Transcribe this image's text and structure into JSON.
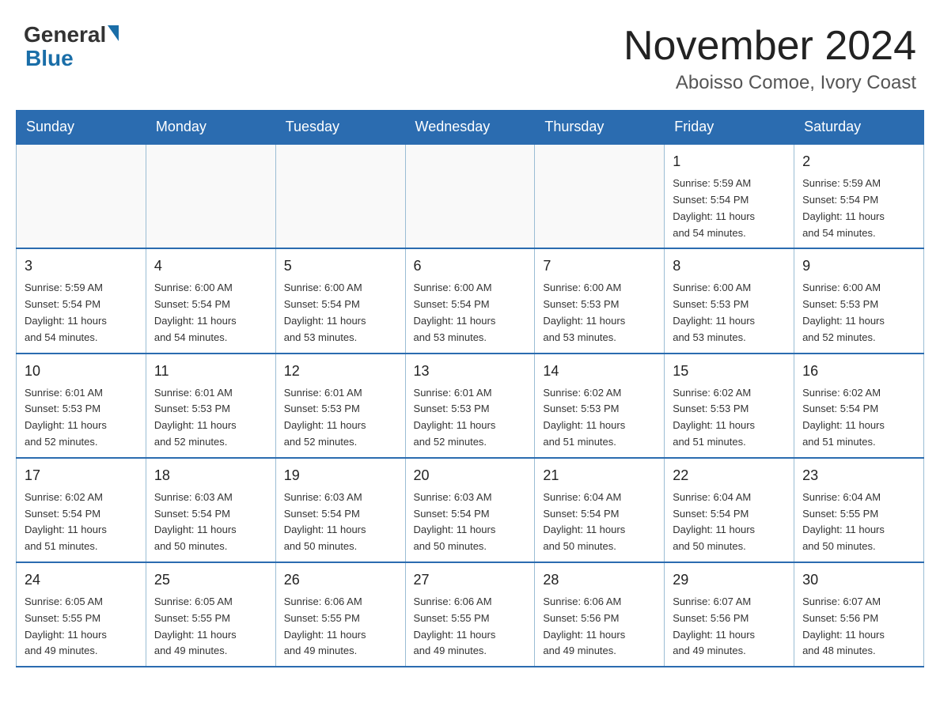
{
  "header": {
    "logo_line1": "General",
    "logo_line2": "Blue",
    "month_title": "November 2024",
    "location": "Aboisso Comoe, Ivory Coast"
  },
  "days_of_week": [
    "Sunday",
    "Monday",
    "Tuesday",
    "Wednesday",
    "Thursday",
    "Friday",
    "Saturday"
  ],
  "weeks": [
    [
      {
        "day": "",
        "info": ""
      },
      {
        "day": "",
        "info": ""
      },
      {
        "day": "",
        "info": ""
      },
      {
        "day": "",
        "info": ""
      },
      {
        "day": "",
        "info": ""
      },
      {
        "day": "1",
        "info": "Sunrise: 5:59 AM\nSunset: 5:54 PM\nDaylight: 11 hours\nand 54 minutes."
      },
      {
        "day": "2",
        "info": "Sunrise: 5:59 AM\nSunset: 5:54 PM\nDaylight: 11 hours\nand 54 minutes."
      }
    ],
    [
      {
        "day": "3",
        "info": "Sunrise: 5:59 AM\nSunset: 5:54 PM\nDaylight: 11 hours\nand 54 minutes."
      },
      {
        "day": "4",
        "info": "Sunrise: 6:00 AM\nSunset: 5:54 PM\nDaylight: 11 hours\nand 54 minutes."
      },
      {
        "day": "5",
        "info": "Sunrise: 6:00 AM\nSunset: 5:54 PM\nDaylight: 11 hours\nand 53 minutes."
      },
      {
        "day": "6",
        "info": "Sunrise: 6:00 AM\nSunset: 5:54 PM\nDaylight: 11 hours\nand 53 minutes."
      },
      {
        "day": "7",
        "info": "Sunrise: 6:00 AM\nSunset: 5:53 PM\nDaylight: 11 hours\nand 53 minutes."
      },
      {
        "day": "8",
        "info": "Sunrise: 6:00 AM\nSunset: 5:53 PM\nDaylight: 11 hours\nand 53 minutes."
      },
      {
        "day": "9",
        "info": "Sunrise: 6:00 AM\nSunset: 5:53 PM\nDaylight: 11 hours\nand 52 minutes."
      }
    ],
    [
      {
        "day": "10",
        "info": "Sunrise: 6:01 AM\nSunset: 5:53 PM\nDaylight: 11 hours\nand 52 minutes."
      },
      {
        "day": "11",
        "info": "Sunrise: 6:01 AM\nSunset: 5:53 PM\nDaylight: 11 hours\nand 52 minutes."
      },
      {
        "day": "12",
        "info": "Sunrise: 6:01 AM\nSunset: 5:53 PM\nDaylight: 11 hours\nand 52 minutes."
      },
      {
        "day": "13",
        "info": "Sunrise: 6:01 AM\nSunset: 5:53 PM\nDaylight: 11 hours\nand 52 minutes."
      },
      {
        "day": "14",
        "info": "Sunrise: 6:02 AM\nSunset: 5:53 PM\nDaylight: 11 hours\nand 51 minutes."
      },
      {
        "day": "15",
        "info": "Sunrise: 6:02 AM\nSunset: 5:53 PM\nDaylight: 11 hours\nand 51 minutes."
      },
      {
        "day": "16",
        "info": "Sunrise: 6:02 AM\nSunset: 5:54 PM\nDaylight: 11 hours\nand 51 minutes."
      }
    ],
    [
      {
        "day": "17",
        "info": "Sunrise: 6:02 AM\nSunset: 5:54 PM\nDaylight: 11 hours\nand 51 minutes."
      },
      {
        "day": "18",
        "info": "Sunrise: 6:03 AM\nSunset: 5:54 PM\nDaylight: 11 hours\nand 50 minutes."
      },
      {
        "day": "19",
        "info": "Sunrise: 6:03 AM\nSunset: 5:54 PM\nDaylight: 11 hours\nand 50 minutes."
      },
      {
        "day": "20",
        "info": "Sunrise: 6:03 AM\nSunset: 5:54 PM\nDaylight: 11 hours\nand 50 minutes."
      },
      {
        "day": "21",
        "info": "Sunrise: 6:04 AM\nSunset: 5:54 PM\nDaylight: 11 hours\nand 50 minutes."
      },
      {
        "day": "22",
        "info": "Sunrise: 6:04 AM\nSunset: 5:54 PM\nDaylight: 11 hours\nand 50 minutes."
      },
      {
        "day": "23",
        "info": "Sunrise: 6:04 AM\nSunset: 5:55 PM\nDaylight: 11 hours\nand 50 minutes."
      }
    ],
    [
      {
        "day": "24",
        "info": "Sunrise: 6:05 AM\nSunset: 5:55 PM\nDaylight: 11 hours\nand 49 minutes."
      },
      {
        "day": "25",
        "info": "Sunrise: 6:05 AM\nSunset: 5:55 PM\nDaylight: 11 hours\nand 49 minutes."
      },
      {
        "day": "26",
        "info": "Sunrise: 6:06 AM\nSunset: 5:55 PM\nDaylight: 11 hours\nand 49 minutes."
      },
      {
        "day": "27",
        "info": "Sunrise: 6:06 AM\nSunset: 5:55 PM\nDaylight: 11 hours\nand 49 minutes."
      },
      {
        "day": "28",
        "info": "Sunrise: 6:06 AM\nSunset: 5:56 PM\nDaylight: 11 hours\nand 49 minutes."
      },
      {
        "day": "29",
        "info": "Sunrise: 6:07 AM\nSunset: 5:56 PM\nDaylight: 11 hours\nand 49 minutes."
      },
      {
        "day": "30",
        "info": "Sunrise: 6:07 AM\nSunset: 5:56 PM\nDaylight: 11 hours\nand 48 minutes."
      }
    ]
  ]
}
